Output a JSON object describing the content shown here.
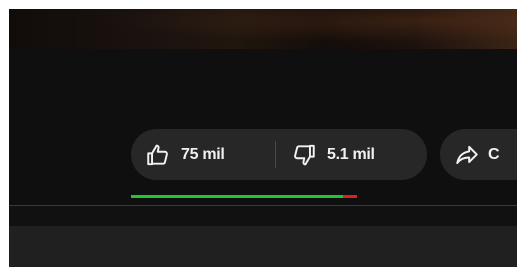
{
  "actions": {
    "like": {
      "icon": "thumbs-up-icon",
      "count": "75 mil"
    },
    "dislike": {
      "icon": "thumbs-down-icon",
      "count": "5.1 mil"
    },
    "share": {
      "icon": "share-arrow-icon",
      "label_visible": "C"
    }
  },
  "ratio_bar": {
    "like_fraction": 0.936,
    "like_color": "#22c630",
    "dislike_color": "#e02020"
  },
  "colors": {
    "background": "#0f0f0f",
    "pill": "#272727",
    "text": "#f1f1f1"
  }
}
